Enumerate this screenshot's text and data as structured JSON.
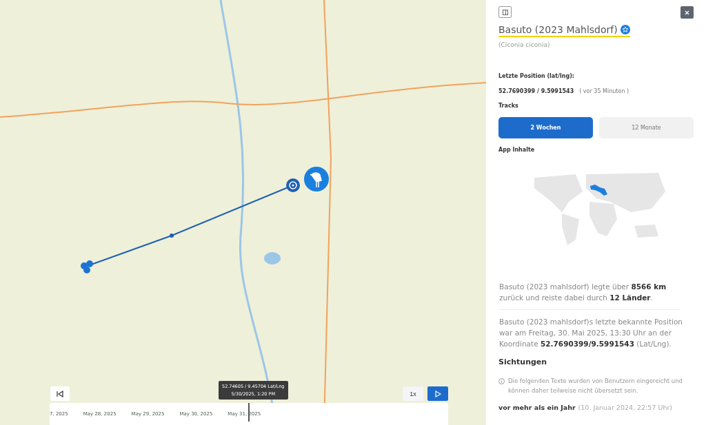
{
  "map": {
    "tooltip": {
      "coords": "52.74605 / 9.45704 Lat/Lng",
      "time": "5/30/2025, 1:20 PM"
    },
    "timeline": {
      "dates": [
        "7, 2025",
        "May 28, 2025",
        "May 29, 2025",
        "May 30, 2025",
        "May 31, 2025"
      ]
    },
    "speed": "1x"
  },
  "panel": {
    "name": "Basuto (2023 Mahlsdorf)",
    "species": "(Ciconia ciconia)",
    "last_position_label": "Letzte Position (lat/lng):",
    "last_position": "52.7690399 / 9.5991543",
    "last_position_age": "( vor 35 Minuten )",
    "tracks_label": "Tracks",
    "tracks": [
      {
        "label": "2 Wochen",
        "selected": true
      },
      {
        "label": "12 Monate",
        "selected": false
      }
    ],
    "app_label": "App Inhalte",
    "summary": "Basuto (2023 mahlsdorf) legte über **8566 km** zurück und reiste dabei durch **12 Länder**.",
    "last_known": "Basuto (2023 mahlsdorf)s letzte bekannte Position war am Freitag, 30. Mai 2025, 13:30 Uhr an der Koordinate **52.7690399/9.5991543** (Lat/Lng).",
    "sightings_title": "Sichtungen",
    "sightings_note": "Die folgenden Texte wurden von Benutzern eingereicht und können daher teilweise nicht übersetzt sein.",
    "sighting": {
      "when": "vor mehr als ein Jahr",
      "date": "(10. Januar 2024, 22:57 Uhr)"
    }
  }
}
